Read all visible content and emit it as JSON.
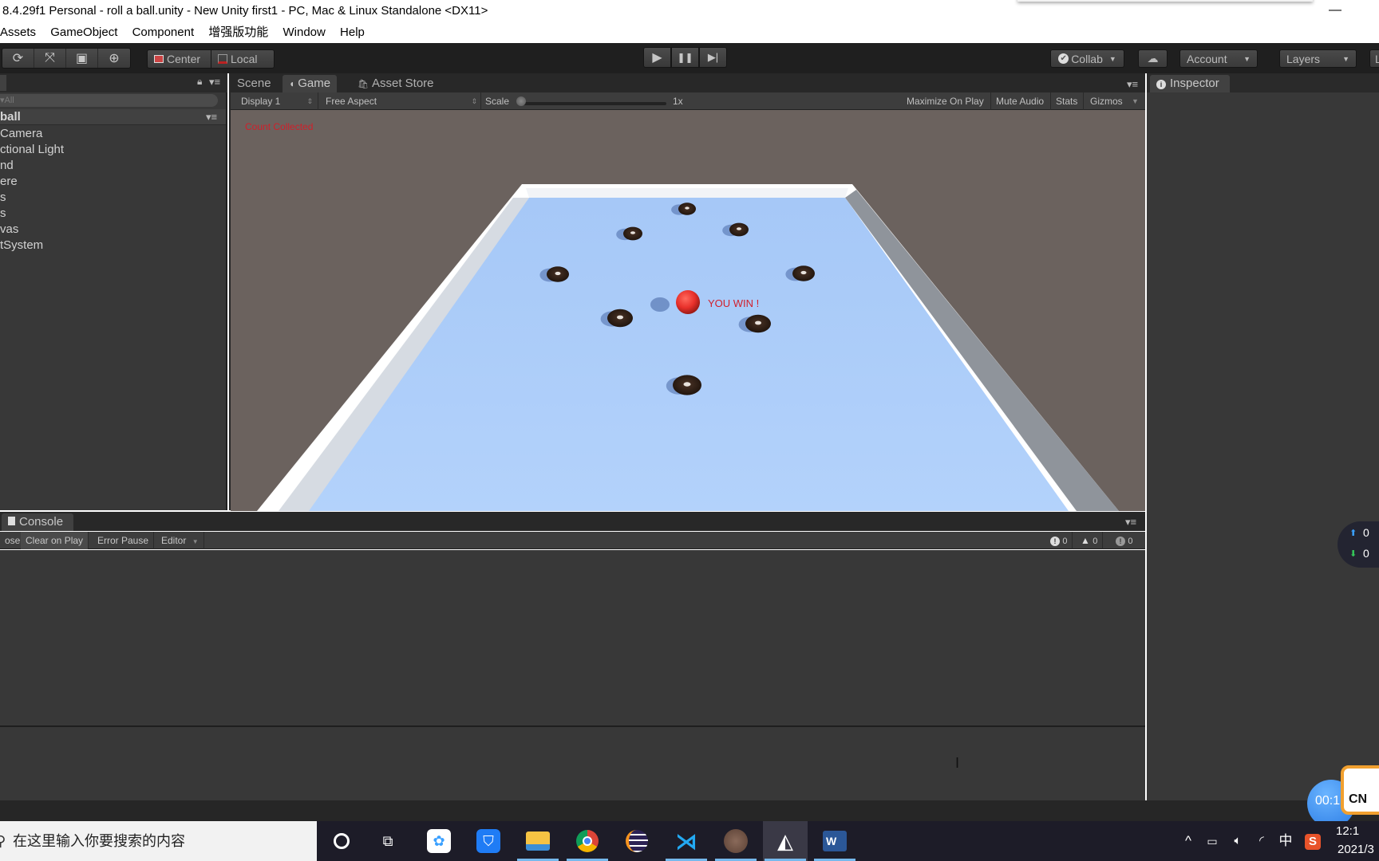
{
  "window": {
    "title": "8.4.29f1 Personal - roll a ball.unity - New Unity first1 - PC, Mac & Linux Standalone <DX11>",
    "minimize_glyph": "—"
  },
  "menubar": [
    "Assets",
    "GameObject",
    "Component",
    "增强版功能",
    "Window",
    "Help"
  ],
  "toolbar": {
    "transform_tools": [
      {
        "icon": "rotate-icon",
        "glyph": "⟳"
      },
      {
        "icon": "scale-icon",
        "glyph": "⤧"
      },
      {
        "icon": "rect-tool-icon",
        "glyph": "▣"
      },
      {
        "icon": "transform-tool-icon",
        "glyph": "⊕"
      }
    ],
    "pivot_label": "Center",
    "rotation_label": "Local",
    "play_glyph": "▶",
    "pause_glyph": "❚❚",
    "step_glyph": "▶|",
    "collab_label": "Collab",
    "account_label": "Account",
    "layers_label": "Layers",
    "layout_label": "L"
  },
  "hierarchy": {
    "search_placeholder": "▾All",
    "scene_name": "ball",
    "items": [
      "Camera",
      "ctional Light",
      "nd",
      "ere",
      "s",
      "s",
      "vas",
      "tSystem"
    ]
  },
  "game_panel": {
    "tabs": [
      {
        "label": "Scene",
        "active": false
      },
      {
        "label": "Game",
        "active": true
      },
      {
        "label": "Asset Store",
        "active": false
      }
    ],
    "display_label": "Display 1",
    "aspect_label": "Free Aspect",
    "scale_label": "Scale",
    "scale_value": "1x",
    "scale_fraction": 0.0,
    "maximize_label": "Maximize On Play",
    "mute_label": "Mute Audio",
    "stats_label": "Stats",
    "gizmos_label": "Gizmos",
    "hud_counter_text": "Count Collected",
    "win_text": "YOU WIN !",
    "colors": {
      "sky": "#6b625e",
      "floor": "#aecdf7",
      "wall": "#ffffff",
      "ball": "#e8302a",
      "hud_text": "#d11f2a"
    }
  },
  "inspector": {
    "tab_label": "Inspector"
  },
  "console": {
    "tab_label": "Console",
    "buttons": [
      "ose",
      "Clear on Play",
      "Error Pause",
      "Editor"
    ],
    "counts": {
      "errors": "0",
      "warnings": "0",
      "messages": "0"
    }
  },
  "net_widget": {
    "upload": "0",
    "download": "0"
  },
  "timer_text": "00:1",
  "badge_text": "CN",
  "taskbar": {
    "search_placeholder": "在这里输入你要搜索的内容",
    "apps": [
      {
        "name": "cortana",
        "active": false
      },
      {
        "name": "task-view",
        "active": false
      },
      {
        "name": "baidu-netdisk",
        "active": false
      },
      {
        "name": "tencent-pc-manager",
        "active": false
      },
      {
        "name": "file-explorer",
        "active": true
      },
      {
        "name": "chrome",
        "active": true
      },
      {
        "name": "eclipse",
        "active": false
      },
      {
        "name": "vscode",
        "active": true
      },
      {
        "name": "photo-app",
        "active": true
      },
      {
        "name": "unity",
        "active": true
      },
      {
        "name": "word",
        "active": true
      }
    ],
    "tray_ime": "中",
    "clock_time": "12:1",
    "clock_date": "2021/3"
  }
}
